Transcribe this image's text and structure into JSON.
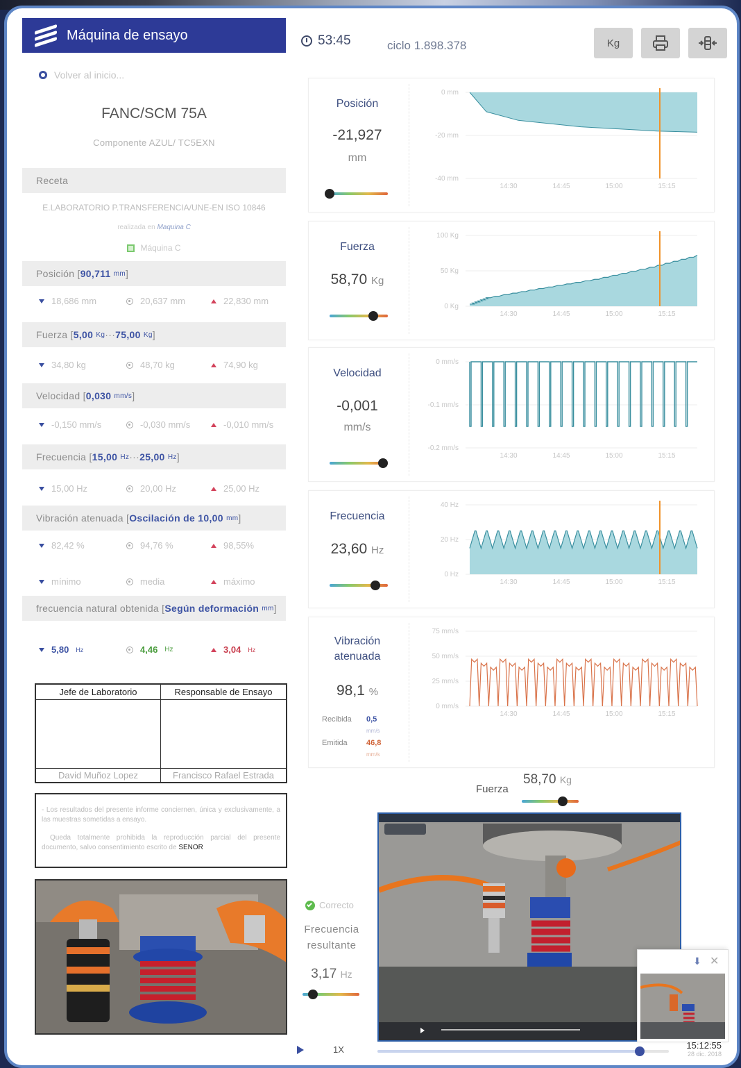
{
  "app": {
    "title": "Máquina de ensayo",
    "back": "Volver al inicio..."
  },
  "piece": {
    "name": "FANC/SCM 75A",
    "component": "Componente AZUL/ TC5EXN"
  },
  "recipe": {
    "header": "Receta",
    "name": "E.LABORATORIO P.TRANSFERENCIA/UNE-EN ISO 10846",
    "realized_prefix": "realizada en",
    "realized_machine": "Maquina C",
    "machine_check": "Máquina C"
  },
  "sections": [
    {
      "label": "Posición [",
      "value": "90,711",
      "unit": "mm",
      "close": "]",
      "min": "18,686 mm",
      "avg": "20,637 mm",
      "max": "22,830 mm"
    },
    {
      "label": "Fuerza [",
      "value": "5,00",
      "unit": "Kg",
      "sep": " ··· ",
      "value2": "75,00",
      "unit2": "Kg",
      "close": "]",
      "min": "34,80 kg",
      "avg": "48,70 kg",
      "max": "74,90 kg"
    },
    {
      "label": "Velocidad [",
      "value": "0,030",
      "unit": "mm/s",
      "close": "]",
      "min": "-0,150 mm/s",
      "avg": "-0,030 mm/s",
      "max": "-0,010 mm/s"
    },
    {
      "label": "Frecuencia [",
      "value": "15,00",
      "unit": "Hz",
      "sep": " ··· ",
      "value2": "25,00",
      "unit2": "Hz",
      "close": "]",
      "min": "15,00 Hz",
      "avg": "20,00 Hz",
      "max": "25,00 Hz"
    },
    {
      "label": "Vibración atenuada [",
      "value": "Oscilación de 10,00",
      "unit": "mm",
      "close": "]",
      "min": "82,42 %",
      "avg": "94,76 %",
      "max": "98,55%"
    }
  ],
  "legend_row": {
    "min": "mínimo",
    "avg": "media",
    "max": "máximo"
  },
  "natural": {
    "label": "frecuencia natural obtenida [",
    "value": "Según deformación",
    "unit": "mm",
    "close": "]",
    "min_val": "5,80",
    "min_unit": "Hz",
    "avg_val": "4,46",
    "avg_unit": "Hz",
    "max_val": "3,04",
    "max_unit": "Hz"
  },
  "signatures": {
    "h1": "Jefe de Laboratorio",
    "h2": "Responsable de Ensayo",
    "n1": "David Muñoz Lopez",
    "n2": "Francisco Rafael Estrada"
  },
  "notice": {
    "p1": "- Los resultados del presente informe conciernen, única y exclusivamente, a las muestras sometidas a ensayo.",
    "p2": "Queda totalmente prohibida la reproducción parcial del presente documento, salvo consentimiento escrito de",
    "company": "SENOR"
  },
  "toolbar": {
    "time": "53:45",
    "cycle": "ciclo 1.898.378",
    "unit_button": "Kg"
  },
  "cards": {
    "posicion": {
      "label": "Posición",
      "value": "-21,927",
      "unit": "mm",
      "level": 0.0
    },
    "fuerza": {
      "label": "Fuerza",
      "value": "58,70",
      "unit": "Kg",
      "level": 0.75
    },
    "velocidad": {
      "label": "Velocidad",
      "value": "-0,001",
      "unit": "mm/s",
      "level": 0.92
    },
    "frecuencia": {
      "label": "Frecuencia",
      "value": "23,60",
      "unit": "Hz",
      "level": 0.78
    },
    "vibracion": {
      "label1": "Vibración",
      "label2": "atenuada",
      "value": "98,1",
      "unit": "%",
      "recv_label": "Recibida",
      "recv_value": "0,5",
      "recv_unit": "mm/s",
      "emit_label": "Emitida",
      "emit_value": "46,8",
      "emit_unit": "mm/s"
    }
  },
  "bottom": {
    "fuerza_label": "Fuerza",
    "fuerza_value": "58,70",
    "fuerza_unit": "Kg",
    "fuerza_level": 0.72,
    "status": "Correcto",
    "result_label1": "Frecuencia",
    "result_label2": "resultante",
    "result_value": "3,17",
    "result_unit": "Hz",
    "result_level": 0.18,
    "speed": "1X",
    "time": "15:12:55",
    "date": "28 dic. 2018",
    "progress": 0.9
  },
  "colors": {
    "brand": "#2d3a97",
    "chart_fill": "#a9d8df",
    "chart_line": "#3a8f9f",
    "marker": "#f0932b",
    "vib_line": "#d9734a"
  },
  "chart_data": [
    {
      "type": "area",
      "title": "Posición",
      "x": [
        "14:20",
        "14:30",
        "14:45",
        "15:00",
        "15:15",
        "15:25"
      ],
      "ylim": [
        -40,
        0
      ],
      "yticks": [
        "0 mm",
        "-20 mm",
        "-40 mm"
      ],
      "xticks": [
        "14:30",
        "14:45",
        "15:00",
        "15:15"
      ],
      "y": [
        0,
        -9,
        -13,
        -16,
        -18,
        -18.5
      ],
      "marker": "15:15"
    },
    {
      "type": "area",
      "title": "Fuerza",
      "x": [
        "14:20",
        "14:30",
        "14:45",
        "15:00",
        "15:15",
        "15:25"
      ],
      "ylim": [
        0,
        100
      ],
      "yticks": [
        "100 Kg",
        "50 Kg",
        "0 Kg"
      ],
      "xticks": [
        "14:30",
        "14:45",
        "15:00",
        "15:15"
      ],
      "y": [
        3,
        12,
        25,
        38,
        55,
        72
      ],
      "marker": "15:15"
    },
    {
      "type": "line",
      "title": "Velocidad",
      "ylim": [
        -0.2,
        0
      ],
      "yticks": [
        "0 mm/s",
        "-0.1 mm/s",
        "-0.2 mm/s"
      ],
      "xticks": [
        "14:30",
        "14:45",
        "15:00",
        "15:15"
      ],
      "baseline": 0,
      "pulse": -0.15,
      "pulses": 20
    },
    {
      "type": "area",
      "title": "Frecuencia",
      "ylim": [
        0,
        40
      ],
      "yticks": [
        "40 Hz",
        "20 Hz",
        "0 Hz"
      ],
      "xticks": [
        "14:30",
        "14:45",
        "15:00",
        "15:15"
      ],
      "low": 15,
      "high": 25,
      "cycles": 20,
      "marker": "15:15"
    },
    {
      "type": "line",
      "title": "Vibración atenuada",
      "ylim": [
        0,
        75
      ],
      "yticks": [
        "75 mm/s",
        "50 mm/s",
        "25 mm/s",
        "0 mm/s"
      ],
      "xticks": [
        "14:30",
        "14:45",
        "15:00",
        "15:15"
      ],
      "high": 47,
      "low": 0,
      "cycles": 24
    }
  ]
}
